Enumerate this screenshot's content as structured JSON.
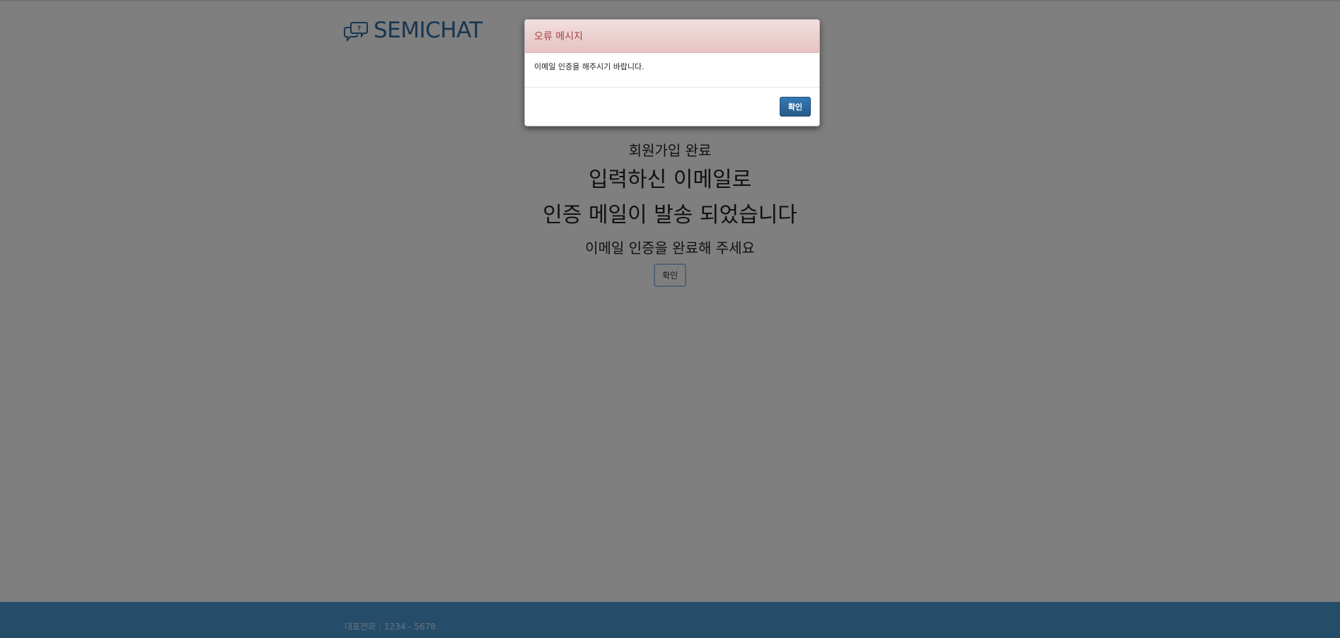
{
  "header": {
    "logo_text": "SEMICHAT",
    "logo_icon": "chat-bubbles-icon"
  },
  "content": {
    "line1": "회원가입 완료",
    "line2": "입력하신 이메일로",
    "line3": "인증 메일이 발송 되었습니다",
    "line4": "이메일 인증을 완료해 주세요",
    "confirm_label": "확인"
  },
  "footer": {
    "phone_text": "대표전화 : 1234 - 5678"
  },
  "modal": {
    "title": "오류 메시지",
    "message": "이메일 인증을 해주시기 바랍니다.",
    "ok_label": "확인"
  },
  "colors": {
    "brand": "#2e6da4",
    "footer": "#4a9ad4",
    "alert_header": "#f2dede",
    "alert_title": "#a94442",
    "primary_button": "#337ab7"
  }
}
